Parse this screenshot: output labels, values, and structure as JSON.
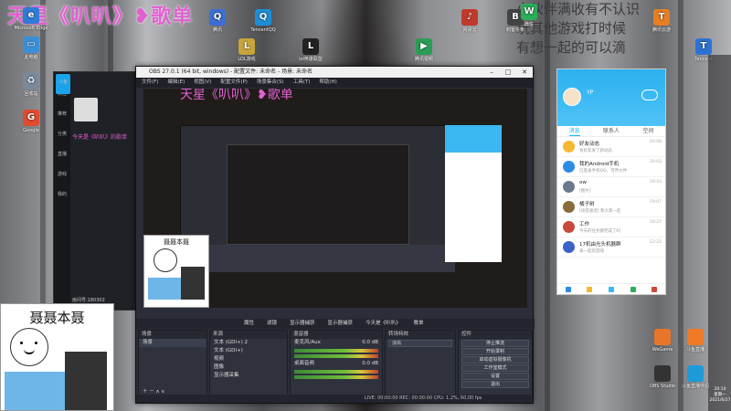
{
  "banner": {
    "text": "天星《叭叭》❥歌单"
  },
  "poem": {
    "lines": [
      "小伙伴满收有不认识",
      "玩其他游戏打时候",
      "有想一起的可以滴"
    ]
  },
  "desktop_icons": [
    {
      "label": "Microsoft Edge",
      "color": "#2f7bd6",
      "glyph": "e"
    },
    {
      "label": "此电脑",
      "color": "#3a8fd8",
      "glyph": "▭"
    },
    {
      "label": "回收站",
      "color": "#7a8a99",
      "glyph": "♻"
    },
    {
      "label": "Google",
      "color": "#e04a2f",
      "glyph": "G"
    },
    {
      "label": "腾讯",
      "color": "#3b6fd4",
      "glyph": "Q"
    },
    {
      "label": "TencentQQ",
      "color": "#1d8ed6",
      "glyph": "Q"
    },
    {
      "label": "LOL游戏",
      "color": "#c8a43a",
      "glyph": "L"
    },
    {
      "label": "lol英雄联盟",
      "color": "#222",
      "glyph": "L"
    },
    {
      "label": "腾讯视频",
      "color": "#2a9d58",
      "glyph": "▶"
    },
    {
      "label": "网易云",
      "color": "#c0392b",
      "glyph": "♪"
    },
    {
      "label": "刺客信条",
      "color": "#444",
      "glyph": "B"
    },
    {
      "label": "微信",
      "color": "#2bad5b",
      "glyph": "W"
    },
    {
      "label": "腾讯云游",
      "color": "#e67e22",
      "glyph": "T"
    },
    {
      "label": "Tencent",
      "color": "#2d72d2",
      "glyph": "T"
    }
  ],
  "douyu": {
    "logo": "斗鱼",
    "nav": [
      "关注",
      "推荐",
      "分类",
      "直播",
      "游戏",
      "我的"
    ],
    "room_id": "房间号:180302",
    "title": "今天是《叭叭》的歌单"
  },
  "obs": {
    "title": "OBS 27.0.1 (64 bit, windows) - 配置文件: 未命名 - 场景: 未命名",
    "menu": [
      "文件(F)",
      "编辑(E)",
      "视图(V)",
      "配置文件(P)",
      "场景集合(S)",
      "工具(T)",
      "帮助(H)"
    ],
    "controls": [
      "属性",
      "滤镜",
      "显示器捕获",
      "显示器捕获",
      "今天是《叭叭》",
      "歌单"
    ],
    "scenes_title": "场景",
    "scenes": [
      "场景"
    ],
    "sources_title": "来源",
    "sources": [
      "文本 (GDI+) 2",
      "文本 (GDI+)",
      "视频",
      "图像",
      "显示器采集"
    ],
    "mixer_title": "混音器",
    "mixer": [
      {
        "name": "麦克风/Aux",
        "db": "0.0 dB"
      },
      {
        "name": "桌面音频",
        "db": "0.0 dB"
      }
    ],
    "transitions_title": "转场特效",
    "transition": "淡出",
    "controls_title": "控件",
    "buttons": [
      "停止推流",
      "开始录制",
      "启动虚拟摄像机",
      "工作室模式",
      "设置",
      "退出"
    ],
    "status": "LIVE: 00:00:00   REC: 00:00:00   CPU: 1.2%, 60.00 fps"
  },
  "qq": {
    "nickname": "YP",
    "tabs": [
      "消息",
      "联系人",
      "空间"
    ],
    "items": [
      {
        "name": "好友动态",
        "msg": "有好友发了新动态",
        "time": "20:08",
        "color": "#f5b82e"
      },
      {
        "name": "我的Android手机",
        "msg": "已登录手机QQ，可传文件",
        "time": "20:03",
        "color": "#2d8be6"
      },
      {
        "name": "ow",
        "msg": "[图片]",
        "time": "19:43",
        "color": "#6b7a8c"
      },
      {
        "name": "橘子树",
        "msg": "[语音通话] 和大家一起",
        "time": "19:07",
        "color": "#8a6b3a"
      },
      {
        "name": "工作",
        "msg": "今天的任务都完成了吗",
        "time": "18:27",
        "color": "#c94a3a"
      },
      {
        "name": "17机由光头机器群",
        "msg": "来一起玩游戏",
        "time": "12:22",
        "color": "#3a62c9"
      }
    ]
  },
  "meme": {
    "caption": "聂聂本聂"
  },
  "taskbar_apps": [
    {
      "label": "WeGame",
      "color": "#e8762a"
    },
    {
      "label": "斗鱼直播",
      "color": "#ef7a27"
    },
    {
      "label": "OBS Studio",
      "color": "#333"
    },
    {
      "label": "斗鱼直播伴侣",
      "color": "#1e9ad8"
    }
  ],
  "clock": {
    "time": "20:10",
    "day": "星期一",
    "date": "2021/6/27"
  }
}
